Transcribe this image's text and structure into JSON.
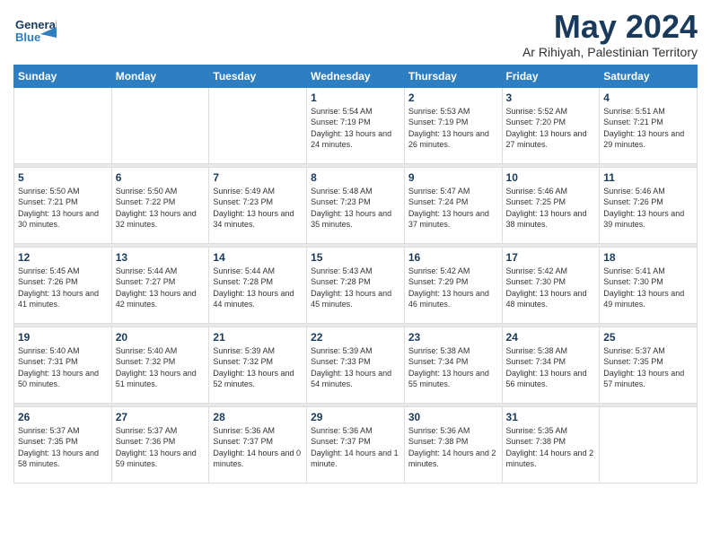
{
  "header": {
    "logo_line1": "General",
    "logo_line2": "Blue",
    "month": "May 2024",
    "location": "Ar Rihiyah, Palestinian Territory"
  },
  "weekdays": [
    "Sunday",
    "Monday",
    "Tuesday",
    "Wednesday",
    "Thursday",
    "Friday",
    "Saturday"
  ],
  "weeks": [
    [
      {
        "day": "",
        "sunrise": "",
        "sunset": "",
        "daylight": ""
      },
      {
        "day": "",
        "sunrise": "",
        "sunset": "",
        "daylight": ""
      },
      {
        "day": "",
        "sunrise": "",
        "sunset": "",
        "daylight": ""
      },
      {
        "day": "1",
        "sunrise": "Sunrise: 5:54 AM",
        "sunset": "Sunset: 7:19 PM",
        "daylight": "Daylight: 13 hours and 24 minutes."
      },
      {
        "day": "2",
        "sunrise": "Sunrise: 5:53 AM",
        "sunset": "Sunset: 7:19 PM",
        "daylight": "Daylight: 13 hours and 26 minutes."
      },
      {
        "day": "3",
        "sunrise": "Sunrise: 5:52 AM",
        "sunset": "Sunset: 7:20 PM",
        "daylight": "Daylight: 13 hours and 27 minutes."
      },
      {
        "day": "4",
        "sunrise": "Sunrise: 5:51 AM",
        "sunset": "Sunset: 7:21 PM",
        "daylight": "Daylight: 13 hours and 29 minutes."
      }
    ],
    [
      {
        "day": "5",
        "sunrise": "Sunrise: 5:50 AM",
        "sunset": "Sunset: 7:21 PM",
        "daylight": "Daylight: 13 hours and 30 minutes."
      },
      {
        "day": "6",
        "sunrise": "Sunrise: 5:50 AM",
        "sunset": "Sunset: 7:22 PM",
        "daylight": "Daylight: 13 hours and 32 minutes."
      },
      {
        "day": "7",
        "sunrise": "Sunrise: 5:49 AM",
        "sunset": "Sunset: 7:23 PM",
        "daylight": "Daylight: 13 hours and 34 minutes."
      },
      {
        "day": "8",
        "sunrise": "Sunrise: 5:48 AM",
        "sunset": "Sunset: 7:23 PM",
        "daylight": "Daylight: 13 hours and 35 minutes."
      },
      {
        "day": "9",
        "sunrise": "Sunrise: 5:47 AM",
        "sunset": "Sunset: 7:24 PM",
        "daylight": "Daylight: 13 hours and 37 minutes."
      },
      {
        "day": "10",
        "sunrise": "Sunrise: 5:46 AM",
        "sunset": "Sunset: 7:25 PM",
        "daylight": "Daylight: 13 hours and 38 minutes."
      },
      {
        "day": "11",
        "sunrise": "Sunrise: 5:46 AM",
        "sunset": "Sunset: 7:26 PM",
        "daylight": "Daylight: 13 hours and 39 minutes."
      }
    ],
    [
      {
        "day": "12",
        "sunrise": "Sunrise: 5:45 AM",
        "sunset": "Sunset: 7:26 PM",
        "daylight": "Daylight: 13 hours and 41 minutes."
      },
      {
        "day": "13",
        "sunrise": "Sunrise: 5:44 AM",
        "sunset": "Sunset: 7:27 PM",
        "daylight": "Daylight: 13 hours and 42 minutes."
      },
      {
        "day": "14",
        "sunrise": "Sunrise: 5:44 AM",
        "sunset": "Sunset: 7:28 PM",
        "daylight": "Daylight: 13 hours and 44 minutes."
      },
      {
        "day": "15",
        "sunrise": "Sunrise: 5:43 AM",
        "sunset": "Sunset: 7:28 PM",
        "daylight": "Daylight: 13 hours and 45 minutes."
      },
      {
        "day": "16",
        "sunrise": "Sunrise: 5:42 AM",
        "sunset": "Sunset: 7:29 PM",
        "daylight": "Daylight: 13 hours and 46 minutes."
      },
      {
        "day": "17",
        "sunrise": "Sunrise: 5:42 AM",
        "sunset": "Sunset: 7:30 PM",
        "daylight": "Daylight: 13 hours and 48 minutes."
      },
      {
        "day": "18",
        "sunrise": "Sunrise: 5:41 AM",
        "sunset": "Sunset: 7:30 PM",
        "daylight": "Daylight: 13 hours and 49 minutes."
      }
    ],
    [
      {
        "day": "19",
        "sunrise": "Sunrise: 5:40 AM",
        "sunset": "Sunset: 7:31 PM",
        "daylight": "Daylight: 13 hours and 50 minutes."
      },
      {
        "day": "20",
        "sunrise": "Sunrise: 5:40 AM",
        "sunset": "Sunset: 7:32 PM",
        "daylight": "Daylight: 13 hours and 51 minutes."
      },
      {
        "day": "21",
        "sunrise": "Sunrise: 5:39 AM",
        "sunset": "Sunset: 7:32 PM",
        "daylight": "Daylight: 13 hours and 52 minutes."
      },
      {
        "day": "22",
        "sunrise": "Sunrise: 5:39 AM",
        "sunset": "Sunset: 7:33 PM",
        "daylight": "Daylight: 13 hours and 54 minutes."
      },
      {
        "day": "23",
        "sunrise": "Sunrise: 5:38 AM",
        "sunset": "Sunset: 7:34 PM",
        "daylight": "Daylight: 13 hours and 55 minutes."
      },
      {
        "day": "24",
        "sunrise": "Sunrise: 5:38 AM",
        "sunset": "Sunset: 7:34 PM",
        "daylight": "Daylight: 13 hours and 56 minutes."
      },
      {
        "day": "25",
        "sunrise": "Sunrise: 5:37 AM",
        "sunset": "Sunset: 7:35 PM",
        "daylight": "Daylight: 13 hours and 57 minutes."
      }
    ],
    [
      {
        "day": "26",
        "sunrise": "Sunrise: 5:37 AM",
        "sunset": "Sunset: 7:35 PM",
        "daylight": "Daylight: 13 hours and 58 minutes."
      },
      {
        "day": "27",
        "sunrise": "Sunrise: 5:37 AM",
        "sunset": "Sunset: 7:36 PM",
        "daylight": "Daylight: 13 hours and 59 minutes."
      },
      {
        "day": "28",
        "sunrise": "Sunrise: 5:36 AM",
        "sunset": "Sunset: 7:37 PM",
        "daylight": "Daylight: 14 hours and 0 minutes."
      },
      {
        "day": "29",
        "sunrise": "Sunrise: 5:36 AM",
        "sunset": "Sunset: 7:37 PM",
        "daylight": "Daylight: 14 hours and 1 minute."
      },
      {
        "day": "30",
        "sunrise": "Sunrise: 5:36 AM",
        "sunset": "Sunset: 7:38 PM",
        "daylight": "Daylight: 14 hours and 2 minutes."
      },
      {
        "day": "31",
        "sunrise": "Sunrise: 5:35 AM",
        "sunset": "Sunset: 7:38 PM",
        "daylight": "Daylight: 14 hours and 2 minutes."
      },
      {
        "day": "",
        "sunrise": "",
        "sunset": "",
        "daylight": ""
      }
    ]
  ]
}
